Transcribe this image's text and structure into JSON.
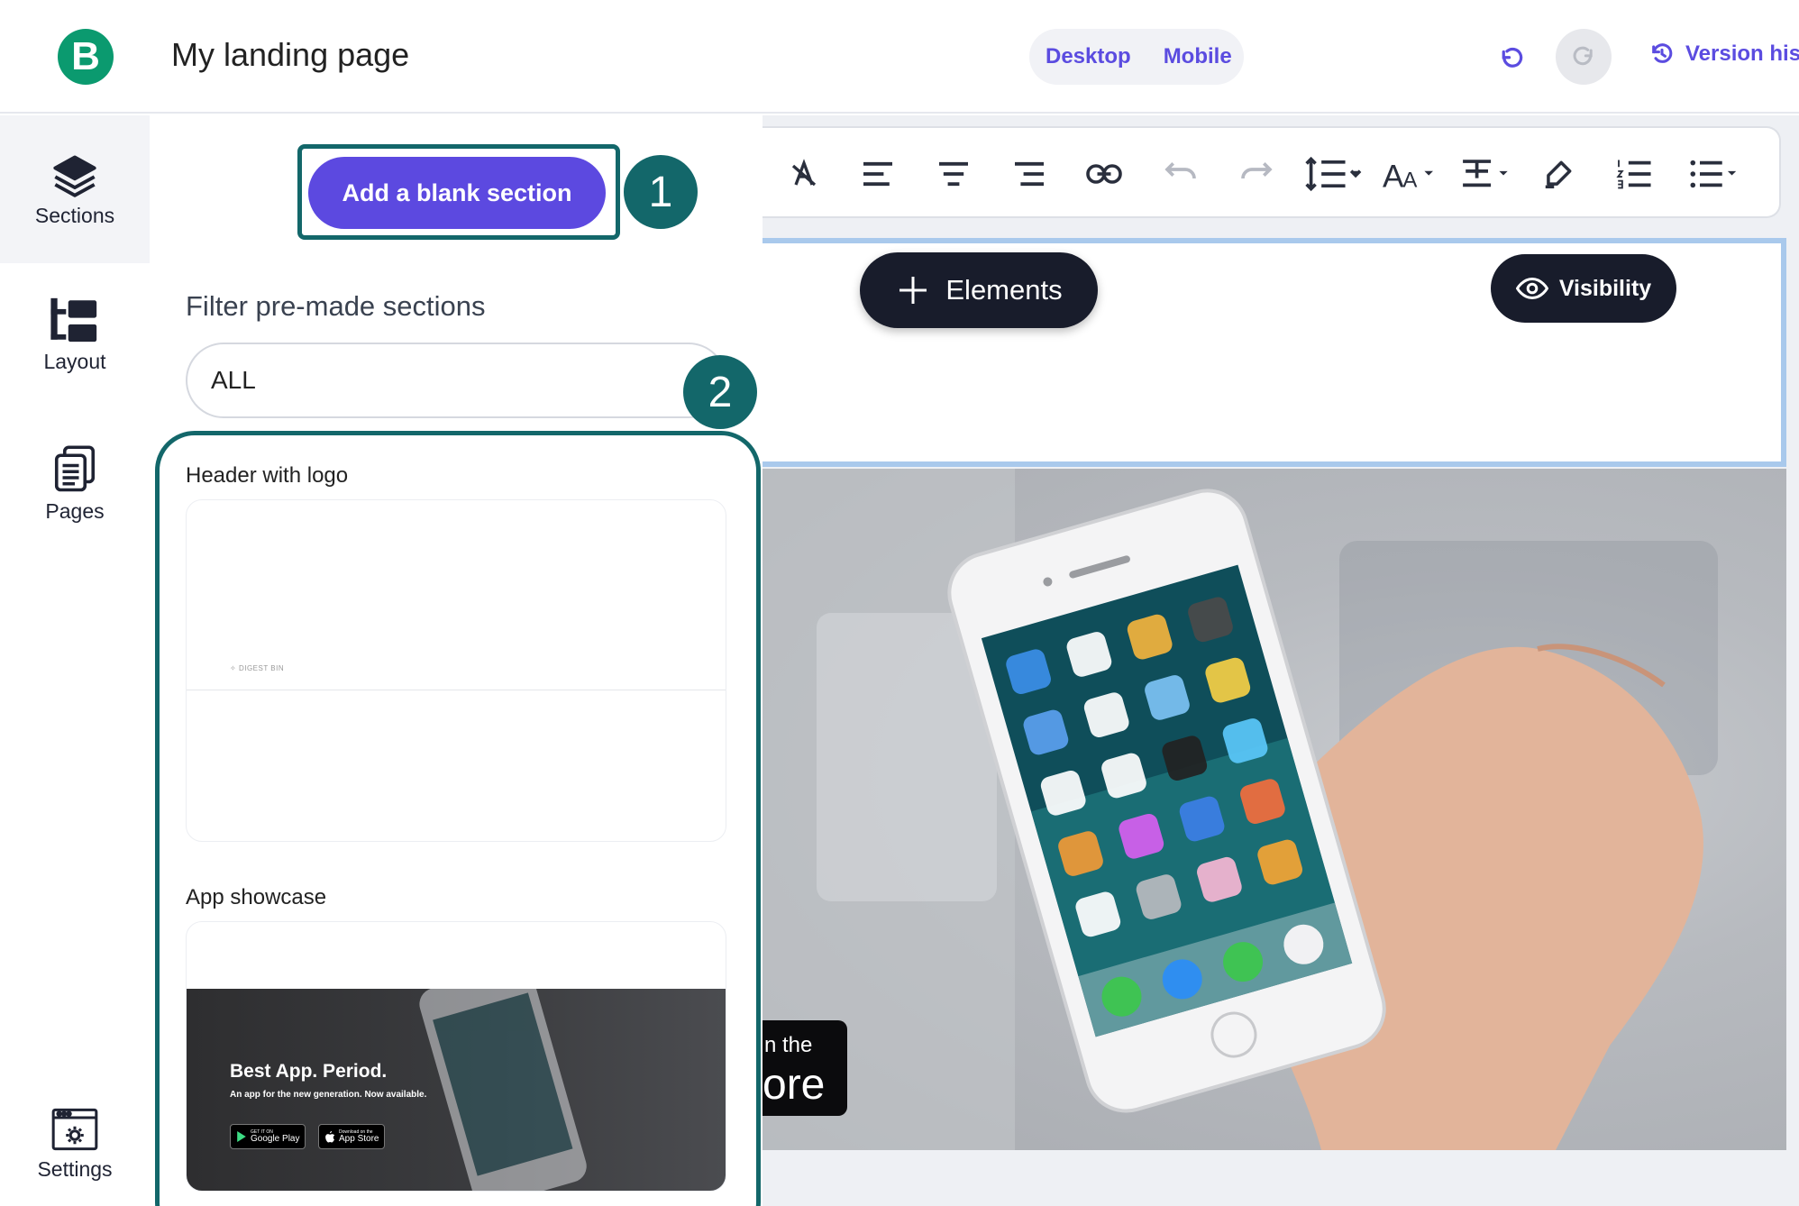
{
  "header": {
    "logo_letter": "B",
    "page_title": "My landing page",
    "device_desktop": "Desktop",
    "device_mobile": "Mobile",
    "version_history": "Version his"
  },
  "rail": {
    "items": [
      {
        "label": "Sections",
        "icon": "layers-icon"
      },
      {
        "label": "Layout",
        "icon": "layout-tree-icon"
      },
      {
        "label": "Pages",
        "icon": "pages-icon"
      },
      {
        "label": "Settings",
        "icon": "settings-window-icon"
      }
    ]
  },
  "panel": {
    "add_blank_label": "Add a blank section",
    "badge_1": "1",
    "badge_2": "2",
    "filter_label": "Filter pre-made sections",
    "filter_value": "ALL",
    "sections": [
      {
        "title": "Header with logo",
        "thumb_logo_text": "DIGEST BIN"
      },
      {
        "title": "App showcase",
        "thumb_heading": "Best App. Period.",
        "thumb_sub": "An app for the new generation. Now available.",
        "google_small": "GET IT ON",
        "google_label": "Google Play",
        "apple_small": "Download on the",
        "apple_label": "App Store"
      }
    ]
  },
  "canvas": {
    "elements_label": "Elements",
    "visibility_label": "Visibility",
    "store_frag_line1": "n the",
    "store_frag_line2": "ore"
  },
  "colors": {
    "accent": "#5c49e0",
    "highlight": "#13676a",
    "brand": "#0b9a6f",
    "dark_button": "#181c2b"
  }
}
